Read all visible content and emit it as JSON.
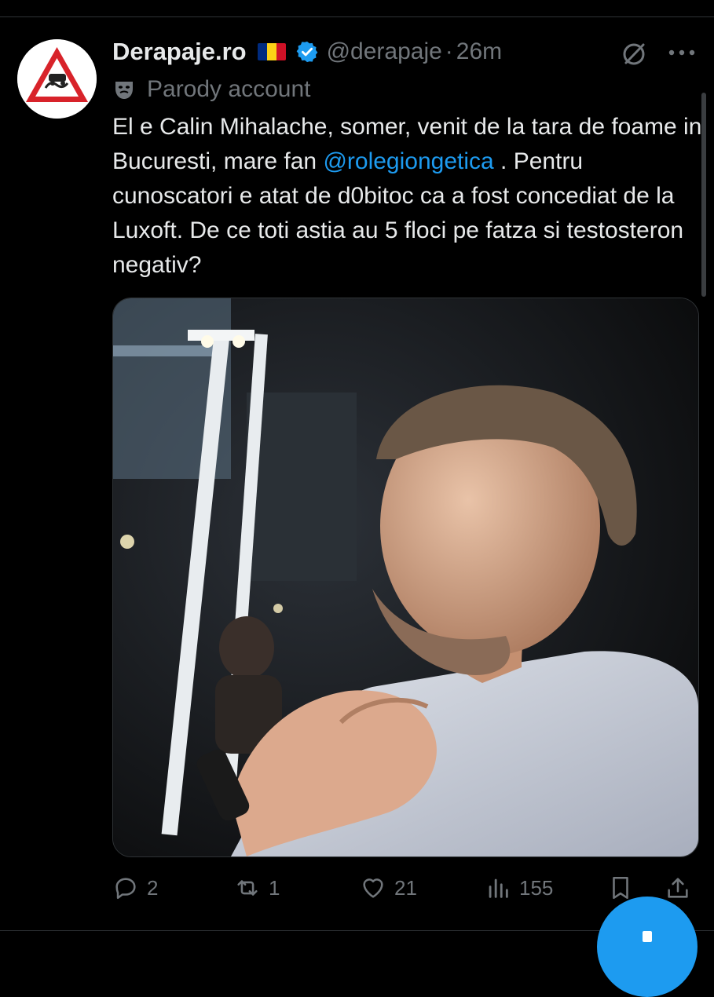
{
  "tweet": {
    "display_name": "Derapaje.ro",
    "handle": "@derapaje",
    "separator": "·",
    "time": "26m",
    "parody_label": "Parody account",
    "text_before_mention": "El e Calin Mihalache, somer, venit de la tara de foame in Bucuresti, mare fan ",
    "mention": "@rolegiongetica",
    "text_after_mention": " . Pentru cunoscatori e atat de d0bitoc ca a fost concediat de la Luxoft. De ce toti astia au 5 floci pe fatza si testosteron negativ?"
  },
  "stats": {
    "replies": "2",
    "reposts": "1",
    "likes": "21",
    "views": "155"
  },
  "colors": {
    "background": "#000000",
    "text": "#e7e9ea",
    "secondary": "#71767b",
    "accent": "#1d9bf0",
    "divider": "#2f3336"
  },
  "icons": {
    "verified": "verified-badge-icon",
    "flag": "romania-flag-icon",
    "grok": "grok-icon",
    "more": "more-icon",
    "parody": "theater-mask-icon",
    "reply": "reply-icon",
    "repost": "repost-icon",
    "like": "heart-icon",
    "views": "views-chart-icon",
    "bookmark": "bookmark-icon",
    "share": "share-icon",
    "compose": "compose-icon"
  }
}
